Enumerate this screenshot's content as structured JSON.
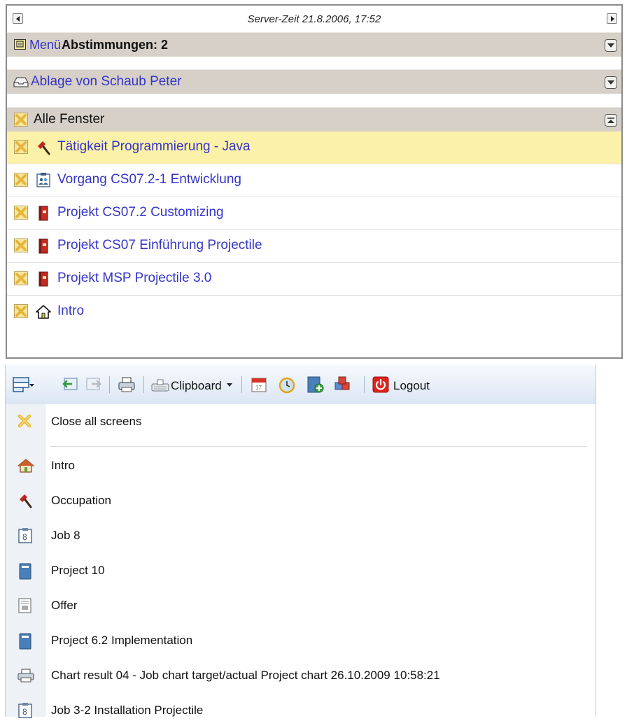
{
  "top_panel": {
    "server_time": "Server-Zeit 21.8.2006, 17:52",
    "menu_bar": {
      "menu_link": "Menü",
      "title": "Abstimmungen: 2"
    },
    "ablage_bar": {
      "label": "Ablage von Schaub Peter"
    },
    "windows_bar": {
      "title": "Alle Fenster"
    },
    "windows": [
      {
        "label": "Tätigkeit Programmierung - Java",
        "icon": "hammer-icon",
        "active": true
      },
      {
        "label": "Vorgang CS07.2-1 Entwicklung",
        "icon": "job-icon"
      },
      {
        "label": "Projekt CS07.2 Customizing",
        "icon": "project-book-icon"
      },
      {
        "label": "Projekt CS07 Einführung Projectile",
        "icon": "project-book-icon"
      },
      {
        "label": "Projekt MSP Projectile 3.0",
        "icon": "project-book-icon"
      },
      {
        "label": "Intro",
        "icon": "home-icon"
      }
    ]
  },
  "bottom_panel": {
    "toolbar": {
      "clipboard_label": "Clipboard",
      "logout_label": "Logout"
    },
    "menu": {
      "close_all": "Close all screens",
      "items": [
        {
          "label": "Intro",
          "icon": "home-icon"
        },
        {
          "label": "Occupation",
          "icon": "hammer-icon"
        },
        {
          "label": "Job 8",
          "icon": "job-icon"
        },
        {
          "label": "Project 10",
          "icon": "project-icon"
        },
        {
          "label": "Offer",
          "icon": "offer-icon"
        },
        {
          "label": "Project 6.2 Implementation",
          "icon": "project-icon"
        },
        {
          "label": "Chart result 04 - Job chart target/actual Project chart 26.10.2009 10:58:21",
          "icon": "printer-icon"
        },
        {
          "label": "Job 3-2 Installation Projectile",
          "icon": "job-icon"
        }
      ]
    }
  }
}
